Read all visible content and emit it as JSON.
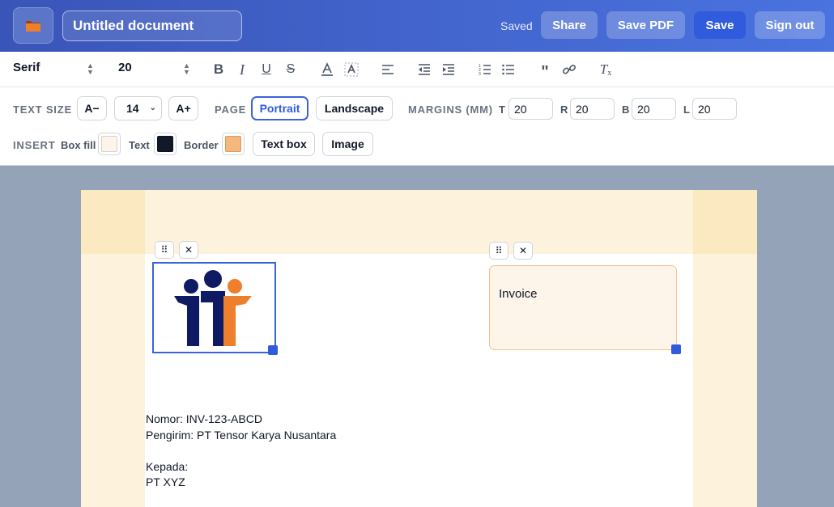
{
  "header": {
    "document_title": "Untitled document",
    "status": "Saved",
    "buttons": {
      "share": "Share",
      "save_pdf": "Save PDF",
      "save": "Save",
      "sign_out": "Sign out"
    },
    "folder_icon": "folder-icon"
  },
  "format_toolbar": {
    "font_family": "Serif",
    "font_size": "20",
    "icons": [
      "bold-icon",
      "italic-icon",
      "underline-icon",
      "strikethrough-icon",
      "text-color-icon",
      "highlight-icon",
      "align-left-icon",
      "outdent-icon",
      "indent-icon",
      "ordered-list-icon",
      "bullet-list-icon",
      "quote-icon",
      "link-icon",
      "clear-format-icon"
    ]
  },
  "options": {
    "text_size_label": "TEXT SIZE",
    "decrease_label": "A−",
    "size_value": "14",
    "increase_label": "A+",
    "page_label": "PAGE",
    "portrait_label": "Portrait",
    "landscape_label": "Landscape",
    "margins_label": "MARGINS (MM)",
    "margins": {
      "t_label": "T",
      "t_value": "20",
      "r_label": "R",
      "r_value": "20",
      "b_label": "B",
      "b_value": "20",
      "l_label": "L",
      "l_value": "20"
    },
    "insert_label": "INSERT",
    "box_fill_label": "Box fill",
    "text_label": "Text",
    "border_label": "Border",
    "text_box_label": "Text box",
    "image_label": "Image",
    "colors": {
      "box_fill": "#fef5ea",
      "text": "#111827",
      "border": "#f4b97a"
    }
  },
  "document": {
    "textbox_text": "Invoice",
    "body_lines": [
      "Nomor: INV-123-ABCD",
      "Pengirim: PT Tensor Karya Nusantara",
      "",
      "Kepada:",
      "PT XYZ"
    ],
    "logo_colors": {
      "navy": "#0e1a63",
      "orange": "#ee7f2d"
    }
  }
}
